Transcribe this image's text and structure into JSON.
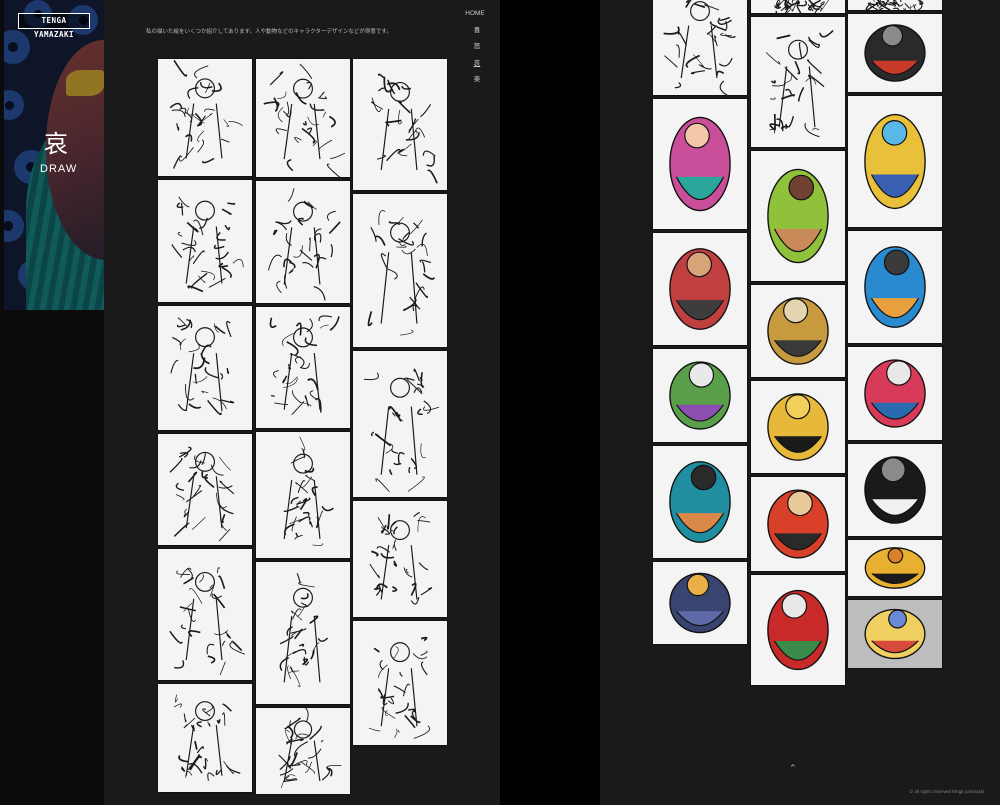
{
  "brand": {
    "logo_text": "TENGA YAMAZAKI"
  },
  "hero": {
    "kanji": "哀",
    "label": "DRAW"
  },
  "intro_text": "私の描いた絵をいくつか紹介してあります。人や動物などのキャラクターデザインなどが得意です。",
  "nav": {
    "home": "HOME",
    "items": [
      "喜",
      "怒",
      "哀",
      "楽"
    ],
    "active_index": 2
  },
  "footer": {
    "scroll_top_icon": "chevron-up-icon",
    "scroll_top_glyph": "⌃",
    "copyright": "© all rights reserved tenga yamazaki"
  },
  "gallery_sketches": {
    "columns": [
      [
        {
          "style": "ink"
        },
        {
          "style": "ink"
        },
        {
          "style": "ink"
        },
        {
          "style": "ink"
        },
        {
          "style": "ink"
        },
        {
          "style": "ink"
        }
      ],
      [
        {
          "style": "ink"
        },
        {
          "style": "ink"
        },
        {
          "style": "ink"
        },
        {
          "style": "ink"
        },
        {
          "style": "ink"
        },
        {
          "style": "ink"
        }
      ],
      [
        {
          "style": "ink"
        },
        {
          "style": "ink"
        },
        {
          "style": "ink"
        },
        {
          "style": "ink"
        },
        {
          "style": "ink"
        }
      ]
    ]
  },
  "gallery_color": {
    "columns": [
      [
        {
          "style": "ink"
        },
        {
          "style": "color",
          "colors": [
            "#c94f9a",
            "#2aa69a",
            "#f2c7a8"
          ]
        },
        {
          "style": "color",
          "colors": [
            "#c04040",
            "#3d3d3d",
            "#d9a37a"
          ]
        },
        {
          "style": "color",
          "colors": [
            "#5aa04a",
            "#8a4fb0",
            "#e9e9e9"
          ]
        },
        {
          "style": "color",
          "colors": [
            "#1f8ea0",
            "#d98848",
            "#2a2a2a"
          ]
        },
        {
          "style": "color",
          "colors": [
            "#3a4470",
            "#5e6aa8",
            "#e9b04a"
          ]
        }
      ],
      [
        {
          "style": "ink"
        },
        {
          "style": "ink"
        },
        {
          "style": "color",
          "colors": [
            "#8fc23a",
            "#c88a58",
            "#704030"
          ]
        },
        {
          "style": "color",
          "colors": [
            "#c89a40",
            "#3a3a3a",
            "#e4d4b0"
          ]
        },
        {
          "style": "color",
          "colors": [
            "#e8b83a",
            "#1a1a1a",
            "#f2cf5a"
          ]
        },
        {
          "style": "color",
          "colors": [
            "#d8402a",
            "#2a2a2a",
            "#e9c89a"
          ]
        },
        {
          "style": "color",
          "colors": [
            "#c82a2a",
            "#3a8a4a",
            "#e8e8e8"
          ]
        }
      ],
      [
        {
          "style": "ink"
        },
        {
          "style": "color",
          "colors": [
            "#2a2a2a",
            "#c83a2a",
            "#8a8a8a"
          ]
        },
        {
          "style": "color",
          "colors": [
            "#e8c03a",
            "#3a5fb0",
            "#58b8e8"
          ]
        },
        {
          "style": "color",
          "colors": [
            "#2a8ad0",
            "#e8a040",
            "#3a3a3a"
          ]
        },
        {
          "style": "color",
          "colors": [
            "#d83a5a",
            "#2a6ab0",
            "#e8e8e8"
          ]
        },
        {
          "style": "color",
          "colors": [
            "#1a1a1a",
            "#f0f0f0",
            "#8a8a8a"
          ]
        },
        {
          "style": "color",
          "colors": [
            "#e8b030",
            "#1a1a1a",
            "#d8802a"
          ]
        },
        {
          "style": "color",
          "colors": [
            "#f0d060",
            "#d84a3a",
            "#6a8ad8"
          ]
        }
      ]
    ]
  }
}
